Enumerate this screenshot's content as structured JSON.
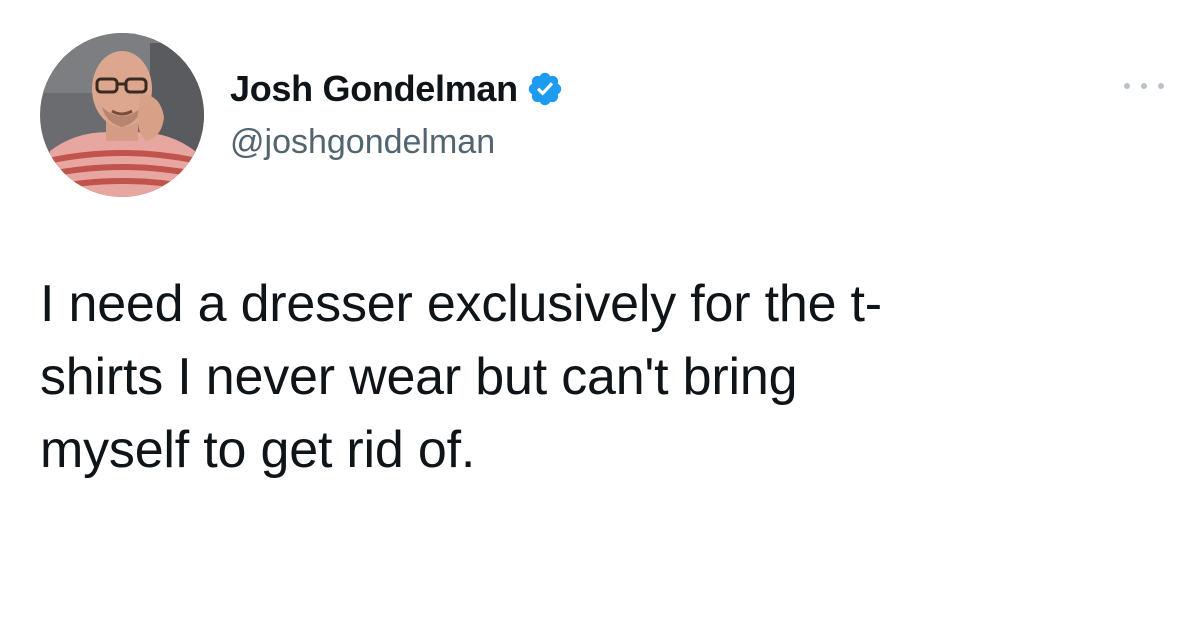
{
  "tweet": {
    "author": {
      "display_name": "Josh Gondelman",
      "handle": "@joshgondelman",
      "verified": true,
      "avatar_icon": "profile-photo"
    },
    "text": "I need a dresser exclusively for the t-\nshirts I never wear but can't bring\nmyself to get rid of.",
    "more_icon": "more-options-icon"
  },
  "colors": {
    "background": "#ffffff",
    "text_primary": "#0f1419",
    "text_secondary": "#536471",
    "verified_blue": "#1d9bf0"
  }
}
